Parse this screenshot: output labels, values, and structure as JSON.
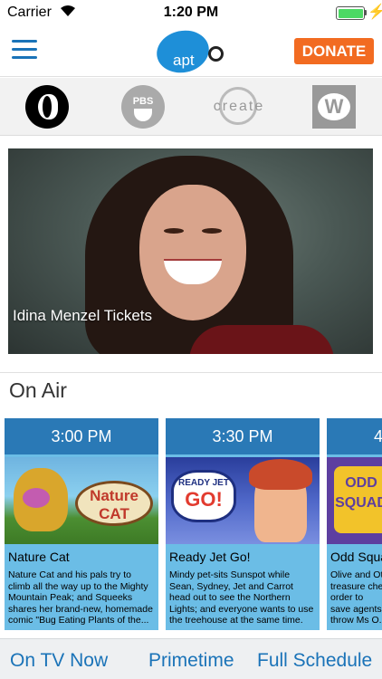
{
  "status_bar": {
    "carrier": "Carrier",
    "time": "1:20 PM",
    "battery_level_percent": 100,
    "battery_color": "#4cd964"
  },
  "header": {
    "logo_text": "apt",
    "donate_label": "DONATE",
    "donate_color": "#f26b21",
    "accent_color": "#1a73b8"
  },
  "channels": [
    {
      "name": "pbs-icon"
    },
    {
      "name": "pbs-kids-icon",
      "label": "PBS"
    },
    {
      "name": "create-icon",
      "label": "create"
    },
    {
      "name": "world-icon",
      "label": "W"
    }
  ],
  "hero": {
    "caption": "Idina Menzel Tickets"
  },
  "on_air": {
    "title": "On Air",
    "cards": [
      {
        "time": "3:00 PM",
        "title": "Nature Cat",
        "thumb_text": "Nature CAT",
        "description": "Nature Cat and his pals try to climb all the way up to the Mighty Mountain Peak; and Squeeks shares her brand-new, homemade comic \"Bug Eating Plants of the..."
      },
      {
        "time": "3:30 PM",
        "title": "Ready Jet Go!",
        "thumb_text_small": "READY JET",
        "thumb_text_big": "GO!",
        "description": "Mindy pet-sits Sunspot while Sean, Sydney, Jet and Carrot head out to see the Northern Lights; and everyone wants to use the treehouse at the same time."
      },
      {
        "time": "4",
        "title": "Odd Squa",
        "thumb_text": "ODD SQUAD",
        "description": "Olive and Ot treasure che order to save agents throw Ms O."
      }
    ]
  },
  "bottom_nav": {
    "items": [
      "On TV Now",
      "Primetime",
      "Full Schedule"
    ]
  }
}
